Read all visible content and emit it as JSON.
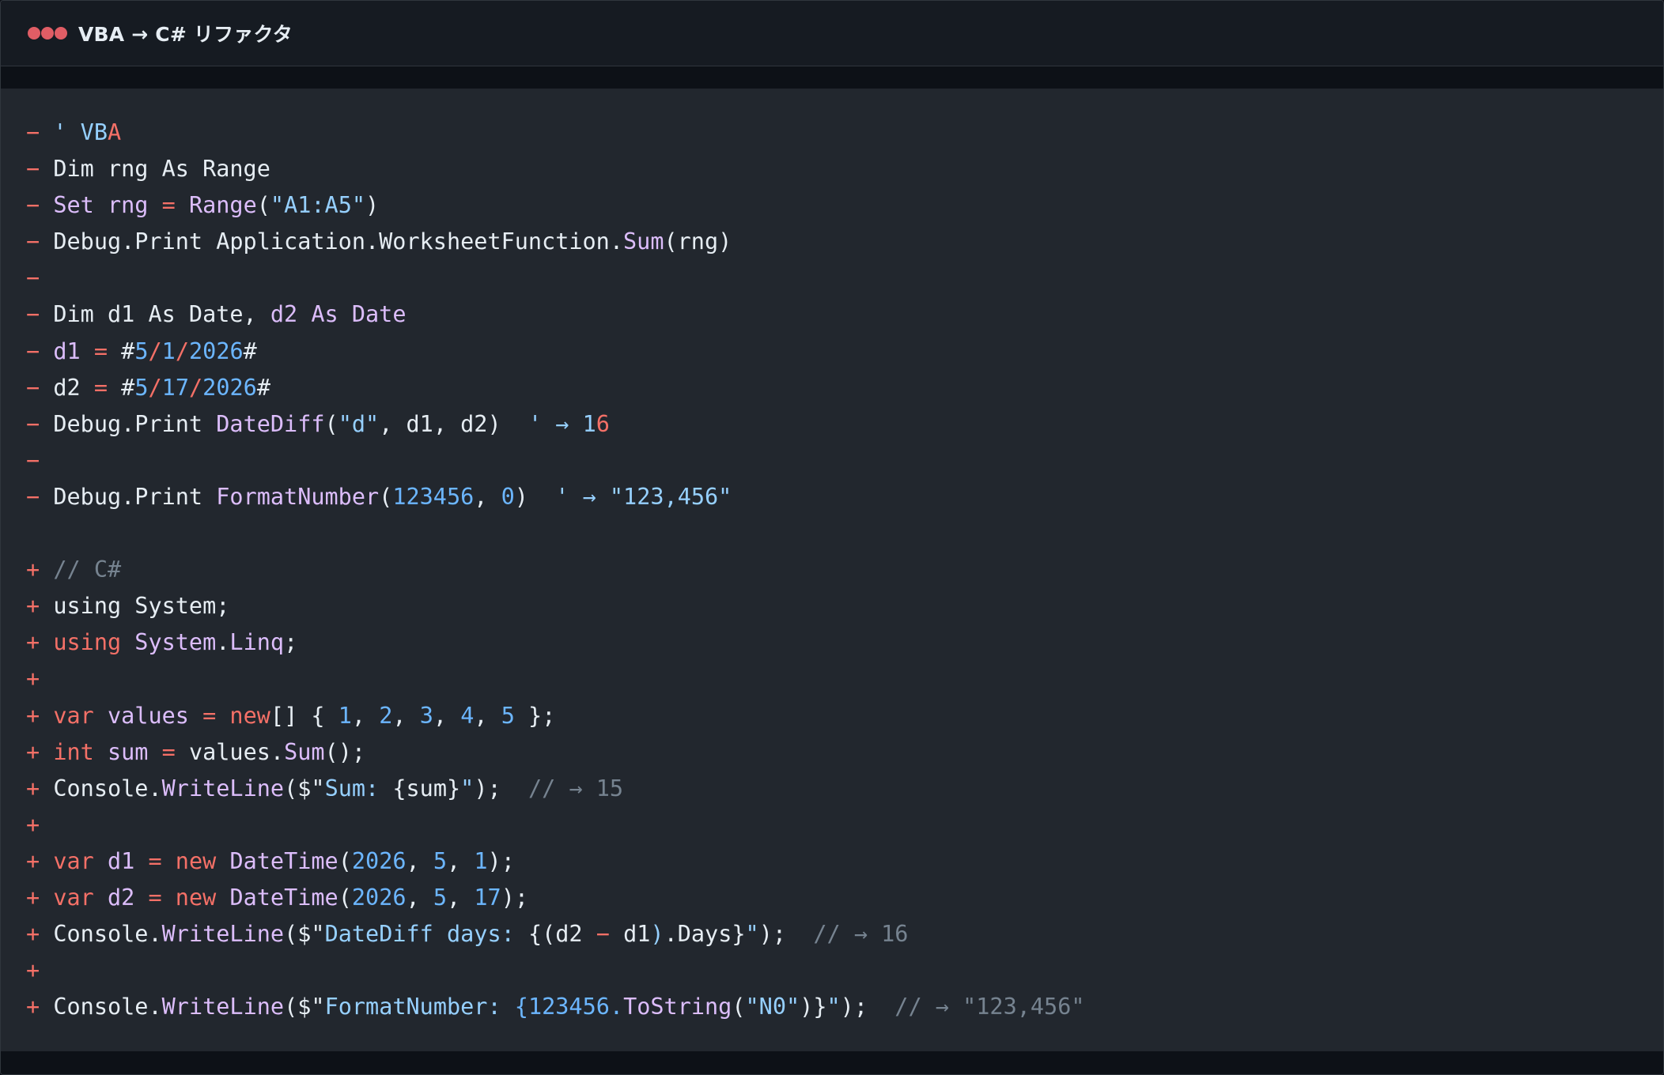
{
  "window": {
    "title": "VBA → C# リファクタ",
    "dot_color": "#e05d65"
  },
  "colors": {
    "background": "#22272e",
    "titlebar": "#161b22",
    "removed_marker": "#f47067",
    "keyword": "#f47067",
    "function": "#dcbdfb",
    "string": "#96d0ff",
    "number": "#6cb6ff",
    "comment": "#768390",
    "text": "#e6edf3"
  },
  "code_lines": [
    {
      "marker": "−",
      "tokens": [
        {
          "t": "' VB",
          "c": "st"
        },
        {
          "t": "A",
          "c": "mk"
        }
      ]
    },
    {
      "marker": "−",
      "tokens": [
        {
          "t": "Dim rng As Range",
          "c": "tx"
        }
      ]
    },
    {
      "marker": "−",
      "tokens": [
        {
          "t": "Set ",
          "c": "fn"
        },
        {
          "t": "rng",
          "c": "fn"
        },
        {
          "t": " = ",
          "c": "kw"
        },
        {
          "t": "Range",
          "c": "fn"
        },
        {
          "t": "(",
          "c": "tx"
        },
        {
          "t": "\"A1:A5\"",
          "c": "st"
        },
        {
          "t": ")",
          "c": "tx"
        }
      ]
    },
    {
      "marker": "−",
      "tokens": [
        {
          "t": "Debug.Print Application.WorksheetFunction.",
          "c": "tx"
        },
        {
          "t": "Sum",
          "c": "fn"
        },
        {
          "t": "(rng)",
          "c": "tx"
        }
      ]
    },
    {
      "marker": "−",
      "tokens": []
    },
    {
      "marker": "−",
      "tokens": [
        {
          "t": "Dim d1 As Date, ",
          "c": "tx"
        },
        {
          "t": "d2 As Date",
          "c": "fn"
        }
      ]
    },
    {
      "marker": "−",
      "tokens": [
        {
          "t": "d1",
          "c": "fn"
        },
        {
          "t": " = ",
          "c": "kw"
        },
        {
          "t": "#",
          "c": "tx"
        },
        {
          "t": "5",
          "c": "nm"
        },
        {
          "t": "/",
          "c": "kw"
        },
        {
          "t": "1",
          "c": "nm"
        },
        {
          "t": "/",
          "c": "kw"
        },
        {
          "t": "2026",
          "c": "nm"
        },
        {
          "t": "#",
          "c": "tx"
        }
      ]
    },
    {
      "marker": "−",
      "tokens": [
        {
          "t": "d2",
          "c": "tx"
        },
        {
          "t": " = ",
          "c": "kw"
        },
        {
          "t": "#",
          "c": "tx"
        },
        {
          "t": "5",
          "c": "nm"
        },
        {
          "t": "/",
          "c": "kw"
        },
        {
          "t": "17",
          "c": "nm"
        },
        {
          "t": "/",
          "c": "kw"
        },
        {
          "t": "2026",
          "c": "nm"
        },
        {
          "t": "#",
          "c": "tx"
        }
      ]
    },
    {
      "marker": "−",
      "tokens": [
        {
          "t": "Debug.Print ",
          "c": "tx"
        },
        {
          "t": "DateDiff",
          "c": "fn"
        },
        {
          "t": "(",
          "c": "tx"
        },
        {
          "t": "\"d\"",
          "c": "st"
        },
        {
          "t": ", d1, d2)  ",
          "c": "tx"
        },
        {
          "t": "' → 1",
          "c": "st"
        },
        {
          "t": "6",
          "c": "mk"
        }
      ]
    },
    {
      "marker": "−",
      "tokens": []
    },
    {
      "marker": "−",
      "tokens": [
        {
          "t": "Debug.Print ",
          "c": "tx"
        },
        {
          "t": "FormatNumber",
          "c": "fn"
        },
        {
          "t": "(",
          "c": "tx"
        },
        {
          "t": "123456",
          "c": "nm"
        },
        {
          "t": ", ",
          "c": "tx"
        },
        {
          "t": "0",
          "c": "nm"
        },
        {
          "t": ")  ",
          "c": "tx"
        },
        {
          "t": "' → \"123,456\"",
          "c": "st"
        }
      ]
    },
    {
      "marker": "",
      "tokens": []
    },
    {
      "marker": "+",
      "tokens": [
        {
          "t": "// C#",
          "c": "cm"
        }
      ]
    },
    {
      "marker": "+",
      "tokens": [
        {
          "t": "using System;",
          "c": "tx"
        }
      ]
    },
    {
      "marker": "+",
      "tokens": [
        {
          "t": "using ",
          "c": "kw"
        },
        {
          "t": "System",
          "c": "fn"
        },
        {
          "t": ".",
          "c": "tx"
        },
        {
          "t": "Linq",
          "c": "fn"
        },
        {
          "t": ";",
          "c": "tx"
        }
      ]
    },
    {
      "marker": "+",
      "tokens": []
    },
    {
      "marker": "+",
      "tokens": [
        {
          "t": "var ",
          "c": "kw"
        },
        {
          "t": "values",
          "c": "fn"
        },
        {
          "t": " = ",
          "c": "kw"
        },
        {
          "t": "new",
          "c": "kw"
        },
        {
          "t": "[] { ",
          "c": "tx"
        },
        {
          "t": "1",
          "c": "nm"
        },
        {
          "t": ", ",
          "c": "tx"
        },
        {
          "t": "2",
          "c": "nm"
        },
        {
          "t": ", ",
          "c": "tx"
        },
        {
          "t": "3",
          "c": "nm"
        },
        {
          "t": ", ",
          "c": "tx"
        },
        {
          "t": "4",
          "c": "nm"
        },
        {
          "t": ", ",
          "c": "tx"
        },
        {
          "t": "5",
          "c": "nm"
        },
        {
          "t": " };",
          "c": "tx"
        }
      ]
    },
    {
      "marker": "+",
      "tokens": [
        {
          "t": "int ",
          "c": "kw"
        },
        {
          "t": "sum",
          "c": "fn"
        },
        {
          "t": " = ",
          "c": "kw"
        },
        {
          "t": "values.",
          "c": "tx"
        },
        {
          "t": "Sum",
          "c": "fn"
        },
        {
          "t": "();",
          "c": "tx"
        }
      ]
    },
    {
      "marker": "+",
      "tokens": [
        {
          "t": "Console.",
          "c": "tx"
        },
        {
          "t": "WriteLine",
          "c": "fn"
        },
        {
          "t": "(",
          "c": "tx"
        },
        {
          "t": "$\"",
          "c": "tx"
        },
        {
          "t": "Sum: ",
          "c": "st"
        },
        {
          "t": "{sum}",
          "c": "tx"
        },
        {
          "t": "\"",
          "c": "st"
        },
        {
          "t": ");  ",
          "c": "tx"
        },
        {
          "t": "// → 15",
          "c": "cm"
        }
      ]
    },
    {
      "marker": "+",
      "tokens": []
    },
    {
      "marker": "+",
      "tokens": [
        {
          "t": "var ",
          "c": "kw"
        },
        {
          "t": "d1",
          "c": "fn"
        },
        {
          "t": " = ",
          "c": "kw"
        },
        {
          "t": "new ",
          "c": "kw"
        },
        {
          "t": "DateTime",
          "c": "fn"
        },
        {
          "t": "(",
          "c": "tx"
        },
        {
          "t": "2026",
          "c": "nm"
        },
        {
          "t": ", ",
          "c": "tx"
        },
        {
          "t": "5",
          "c": "nm"
        },
        {
          "t": ", ",
          "c": "tx"
        },
        {
          "t": "1",
          "c": "nm"
        },
        {
          "t": ");",
          "c": "tx"
        }
      ]
    },
    {
      "marker": "+",
      "tokens": [
        {
          "t": "var ",
          "c": "kw"
        },
        {
          "t": "d2",
          "c": "fn"
        },
        {
          "t": " = ",
          "c": "kw"
        },
        {
          "t": "new ",
          "c": "kw"
        },
        {
          "t": "DateTime",
          "c": "fn"
        },
        {
          "t": "(",
          "c": "tx"
        },
        {
          "t": "2026",
          "c": "nm"
        },
        {
          "t": ", ",
          "c": "tx"
        },
        {
          "t": "5",
          "c": "nm"
        },
        {
          "t": ", ",
          "c": "tx"
        },
        {
          "t": "17",
          "c": "nm"
        },
        {
          "t": ");",
          "c": "tx"
        }
      ]
    },
    {
      "marker": "+",
      "tokens": [
        {
          "t": "Console.",
          "c": "tx"
        },
        {
          "t": "WriteLine",
          "c": "fn"
        },
        {
          "t": "(",
          "c": "tx"
        },
        {
          "t": "$\"",
          "c": "tx"
        },
        {
          "t": "DateDiff days: ",
          "c": "st"
        },
        {
          "t": "{(d2 ",
          "c": "tx"
        },
        {
          "t": "−",
          "c": "kw"
        },
        {
          "t": " d1",
          "c": "tx"
        },
        {
          "t": ")",
          "c": "st"
        },
        {
          "t": ".Days}",
          "c": "tx"
        },
        {
          "t": "\"",
          "c": "st"
        },
        {
          "t": ");  ",
          "c": "tx"
        },
        {
          "t": "// → 16",
          "c": "cm"
        }
      ]
    },
    {
      "marker": "+",
      "tokens": []
    },
    {
      "marker": "+",
      "tokens": [
        {
          "t": "Console.",
          "c": "tx"
        },
        {
          "t": "WriteLine",
          "c": "fn"
        },
        {
          "t": "(",
          "c": "tx"
        },
        {
          "t": "$\"",
          "c": "tx"
        },
        {
          "t": "FormatNumber: ",
          "c": "st"
        },
        {
          "t": "{123456.",
          "c": "nm"
        },
        {
          "t": "ToString",
          "c": "fn"
        },
        {
          "t": "(",
          "c": "tx"
        },
        {
          "t": "\"N0\"",
          "c": "st"
        },
        {
          "t": ")}",
          "c": "tx"
        },
        {
          "t": "\"",
          "c": "st"
        },
        {
          "t": ");  ",
          "c": "tx"
        },
        {
          "t": "// → \"123,456\"",
          "c": "cm"
        }
      ]
    }
  ]
}
